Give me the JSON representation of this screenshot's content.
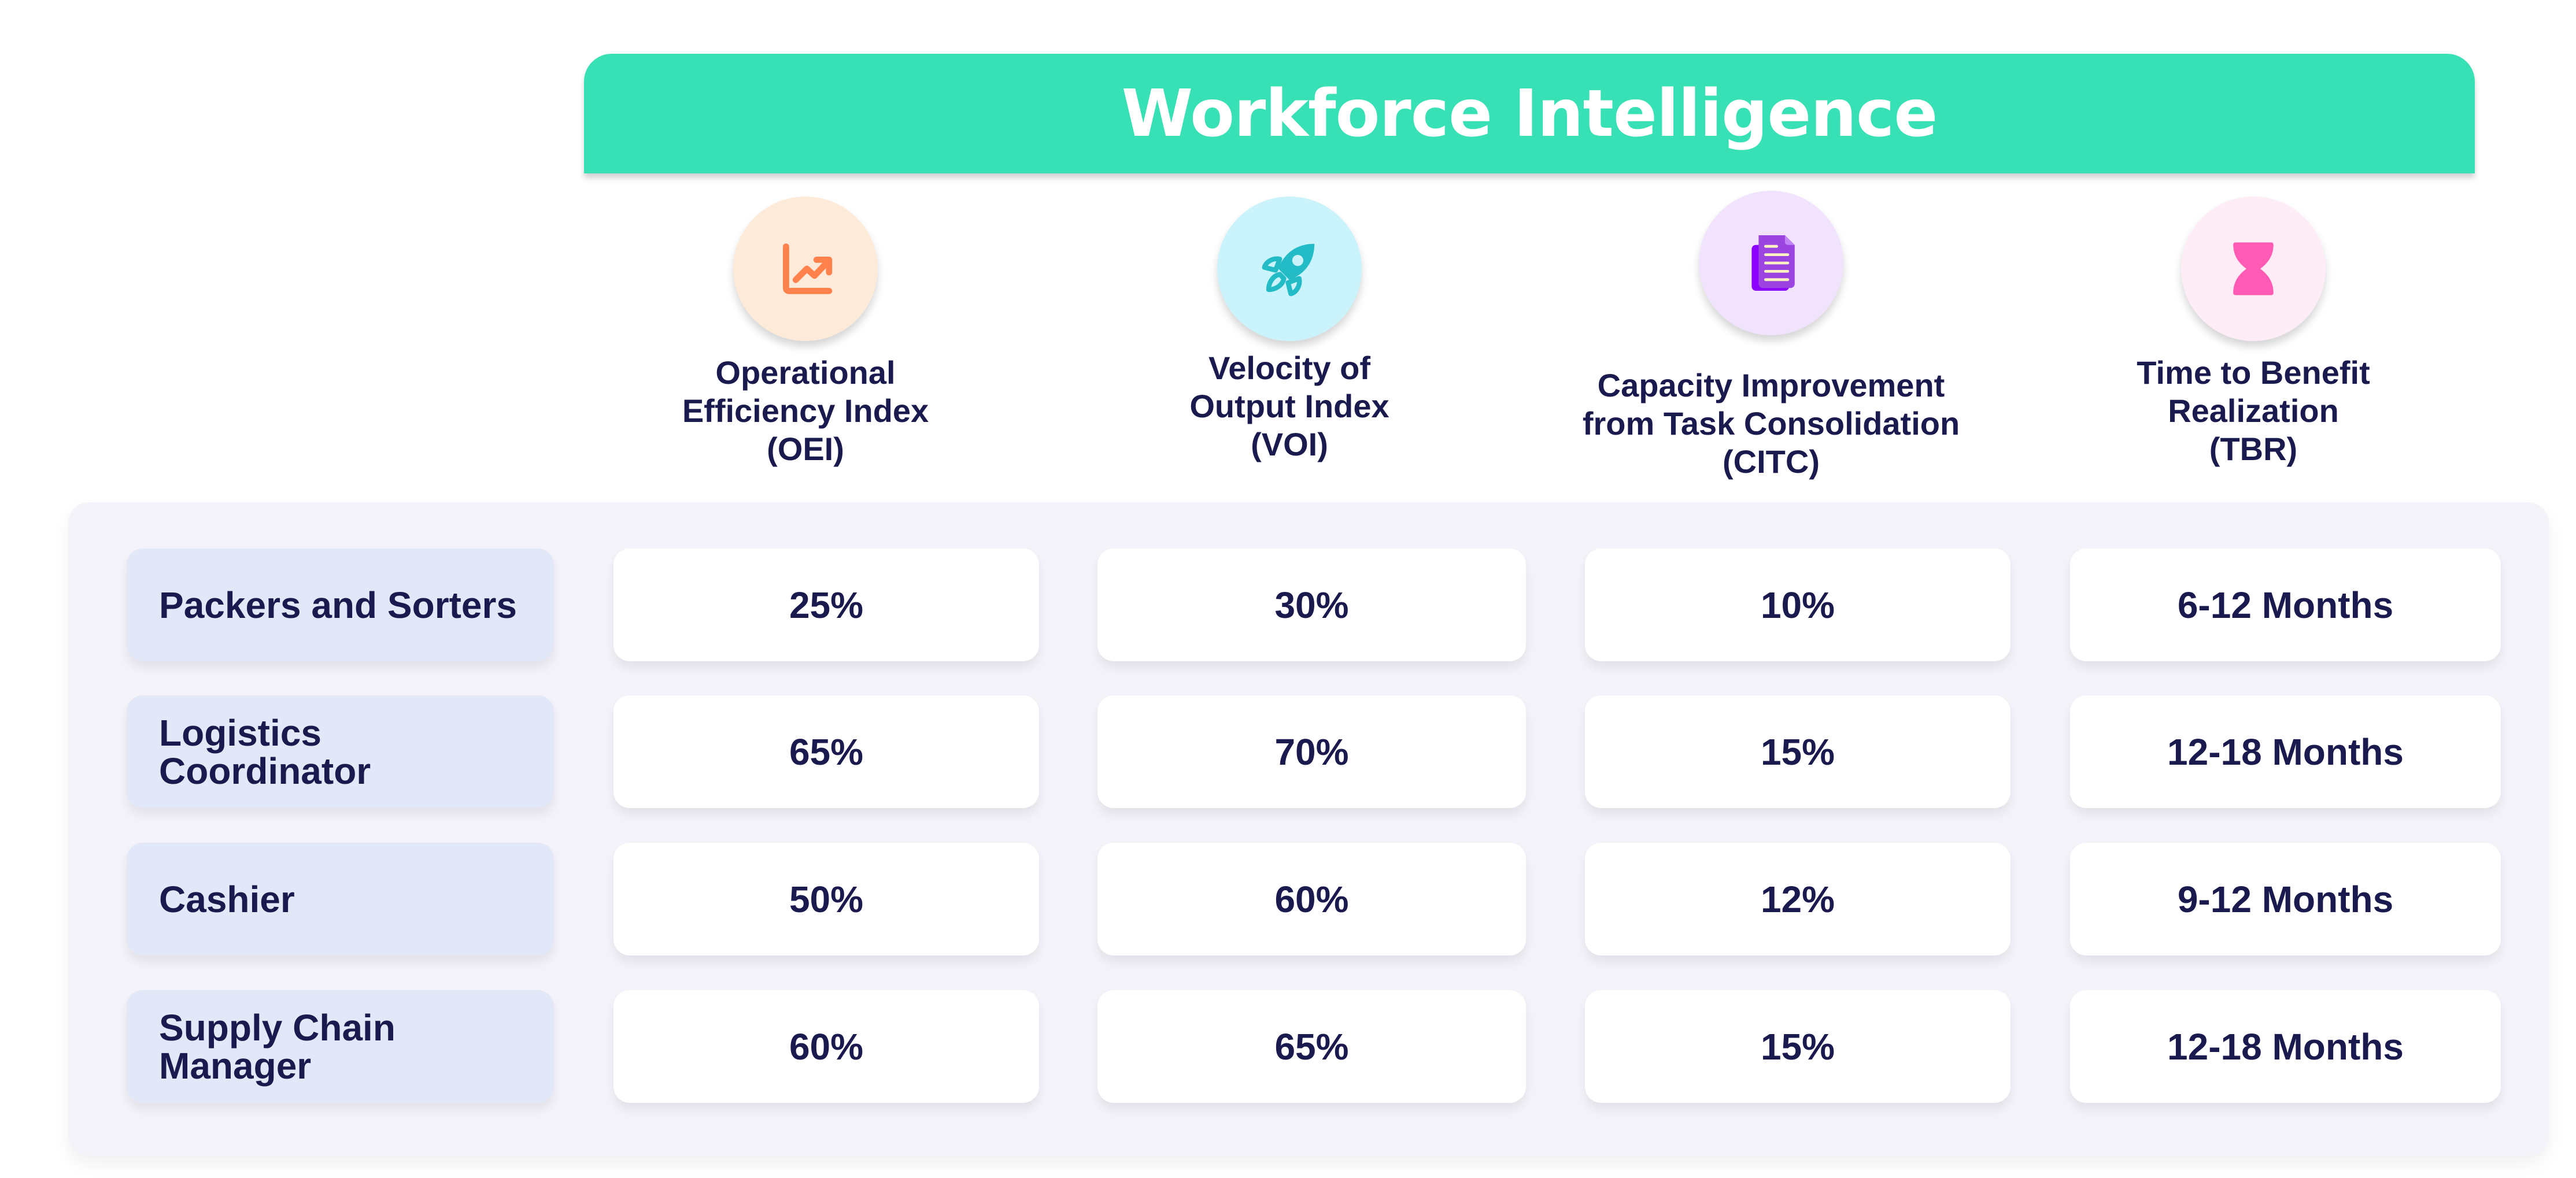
{
  "header": {
    "title": "Workforce Intelligence",
    "accent_color": "#38E1B5"
  },
  "columns": [
    {
      "label_lines": [
        "Operational",
        "Efficiency Index",
        "(OEI)"
      ],
      "icon": "trending-up-chart-icon",
      "icon_color": "#FF824C",
      "icon_bg": "#FEEAD9"
    },
    {
      "label_lines": [
        "Velocity of",
        "Output Index",
        "(VOI)"
      ],
      "icon": "rocket-icon",
      "icon_color": "#22BBC6",
      "icon_bg": "#CBF3FB"
    },
    {
      "label_lines": [
        "Capacity Improvement",
        "from Task Consolidation",
        "(CITC)"
      ],
      "icon": "documents-icon",
      "icon_color": "#9B44E0",
      "icon_bg": "#F1E3FE"
    },
    {
      "label_lines": [
        "Time to Benefit",
        "Realization",
        "(TBR)"
      ],
      "icon": "hourglass-icon",
      "icon_color": "#FF5BB4",
      "icon_bg": "#FEEDF7"
    }
  ],
  "rows": [
    {
      "role_lines": [
        "Packers and Sorters"
      ],
      "values": [
        "25%",
        "30%",
        "10%",
        "6-12 Months"
      ]
    },
    {
      "role_lines": [
        "Logistics",
        "Coordinator"
      ],
      "values": [
        "65%",
        "70%",
        "15%",
        "12-18 Months"
      ]
    },
    {
      "role_lines": [
        "Cashier"
      ],
      "values": [
        "50%",
        "60%",
        "12%",
        "9-12 Months"
      ]
    },
    {
      "role_lines": [
        "Supply Chain",
        "Manager"
      ],
      "values": [
        "60%",
        "65%",
        "15%",
        "12-18 Months"
      ]
    }
  ]
}
